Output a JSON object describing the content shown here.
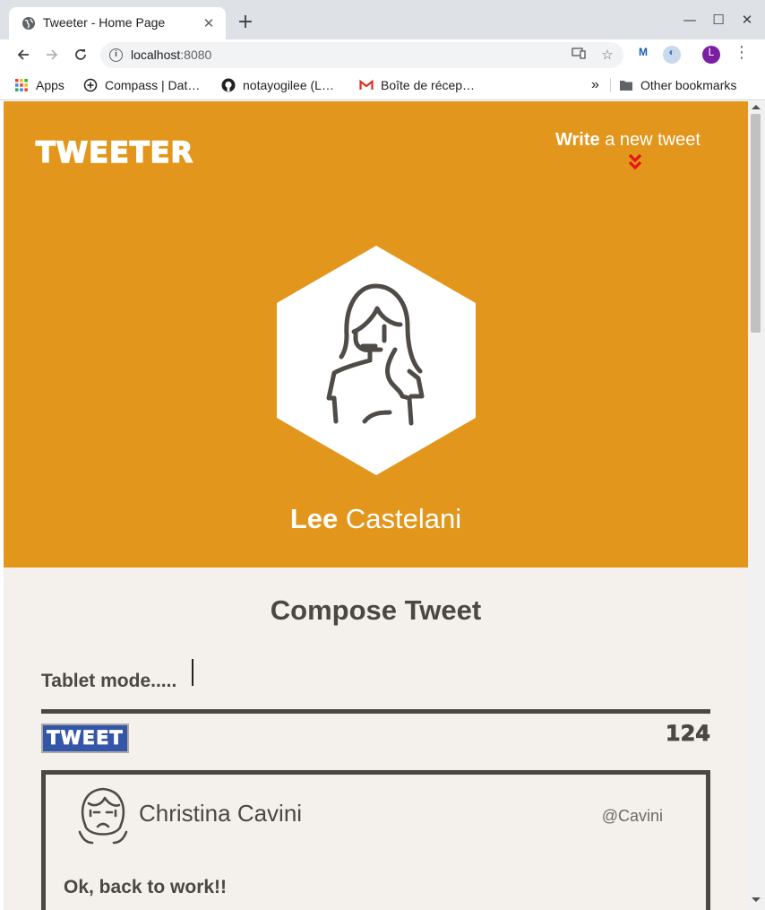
{
  "browser": {
    "tab_title": "Tweeter - Home Page",
    "url_host": "localhost",
    "url_port": ":8080",
    "profile_initial": "L",
    "bookmarks": [
      {
        "label": "Apps",
        "icon": "apps-grid-icon"
      },
      {
        "label": "Compass | Dat…",
        "icon": "compass-icon"
      },
      {
        "label": "notayogilee (L…",
        "icon": "github-icon"
      },
      {
        "label": "Boîte de récep…",
        "icon": "gmail-icon"
      }
    ],
    "overflow_label": "»",
    "other_bookmarks": "Other bookmarks"
  },
  "header": {
    "logo": "TWEETER",
    "write_bold": "Write",
    "write_rest": " a new tweet",
    "chevron_color": "#e8131d",
    "background_color": "#e2961b"
  },
  "profile": {
    "first_name": "Lee",
    "last_name": " Castelani"
  },
  "compose": {
    "title": "Compose Tweet",
    "input_value": "Tablet mode.....",
    "submit_label": "TWEET",
    "char_count": "124"
  },
  "tweets": [
    {
      "name": "Christina Cavini",
      "handle": "@Cavini",
      "text": "Ok, back to work!!"
    }
  ]
}
